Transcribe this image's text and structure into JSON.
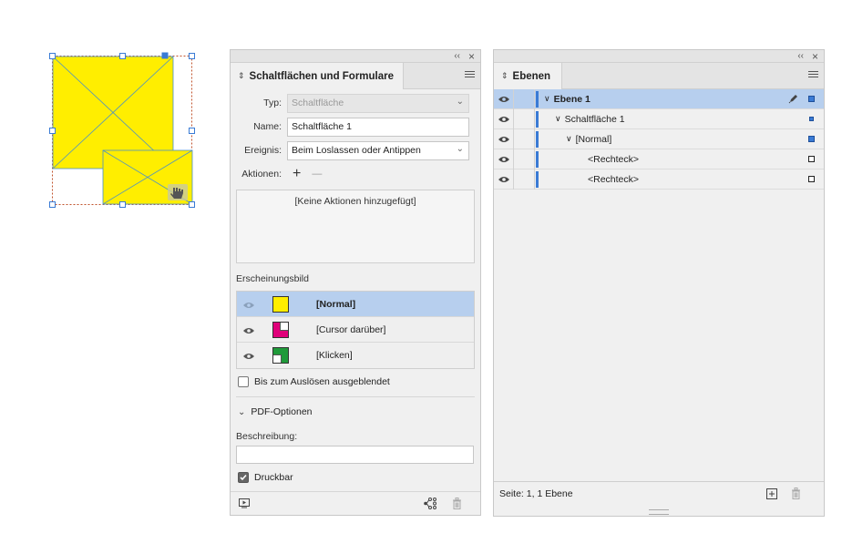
{
  "buttons_panel": {
    "tab_label": "Schaltflächen und Formulare",
    "collapse_glyph": "‹‹",
    "close_glyph": "×",
    "type_label": "Typ:",
    "type_value": "Schaltfläche",
    "name_label": "Name:",
    "name_value": "Schaltfläche 1",
    "event_label": "Ereignis:",
    "event_value": "Beim Loslassen oder Antippen",
    "actions_label": "Aktionen:",
    "add_glyph": "+",
    "remove_glyph": "—",
    "actions_placeholder": "[Keine Aktionen hinzugefügt]",
    "appearance_label": "Erscheinungsbild",
    "appearances": [
      {
        "name": "[Normal]",
        "color": "#ffee00",
        "selected": true
      },
      {
        "name": "[Cursor darüber]",
        "color": "#e0007a",
        "selected": false
      },
      {
        "name": "[Klicken]",
        "color": "#1f9a3a",
        "selected": false
      }
    ],
    "hidden_until_triggered": "Bis zum Auslösen ausgeblendet",
    "pdf_options": "PDF-Optionen",
    "description_label": "Beschreibung:",
    "description_value": "",
    "printable": "Druckbar"
  },
  "layers_panel": {
    "tab_label": "Ebenen",
    "collapse_glyph": "‹‹",
    "close_glyph": "×",
    "rows": [
      {
        "name": "Ebene 1",
        "selected": true
      },
      {
        "name": "Schaltfläche 1",
        "selected": false
      },
      {
        "name": "[Normal]",
        "selected": false
      },
      {
        "name": "<Rechteck>",
        "selected": false
      },
      {
        "name": "<Rechteck>",
        "selected": false
      }
    ],
    "status": "Seite: 1, 1 Ebene"
  },
  "colors": {
    "accent": "#3a7bd5",
    "selection": "#b7cfee",
    "art_yellow": "#ffee00",
    "hover_magenta": "#e0007a",
    "click_green": "#1f9a3a"
  }
}
